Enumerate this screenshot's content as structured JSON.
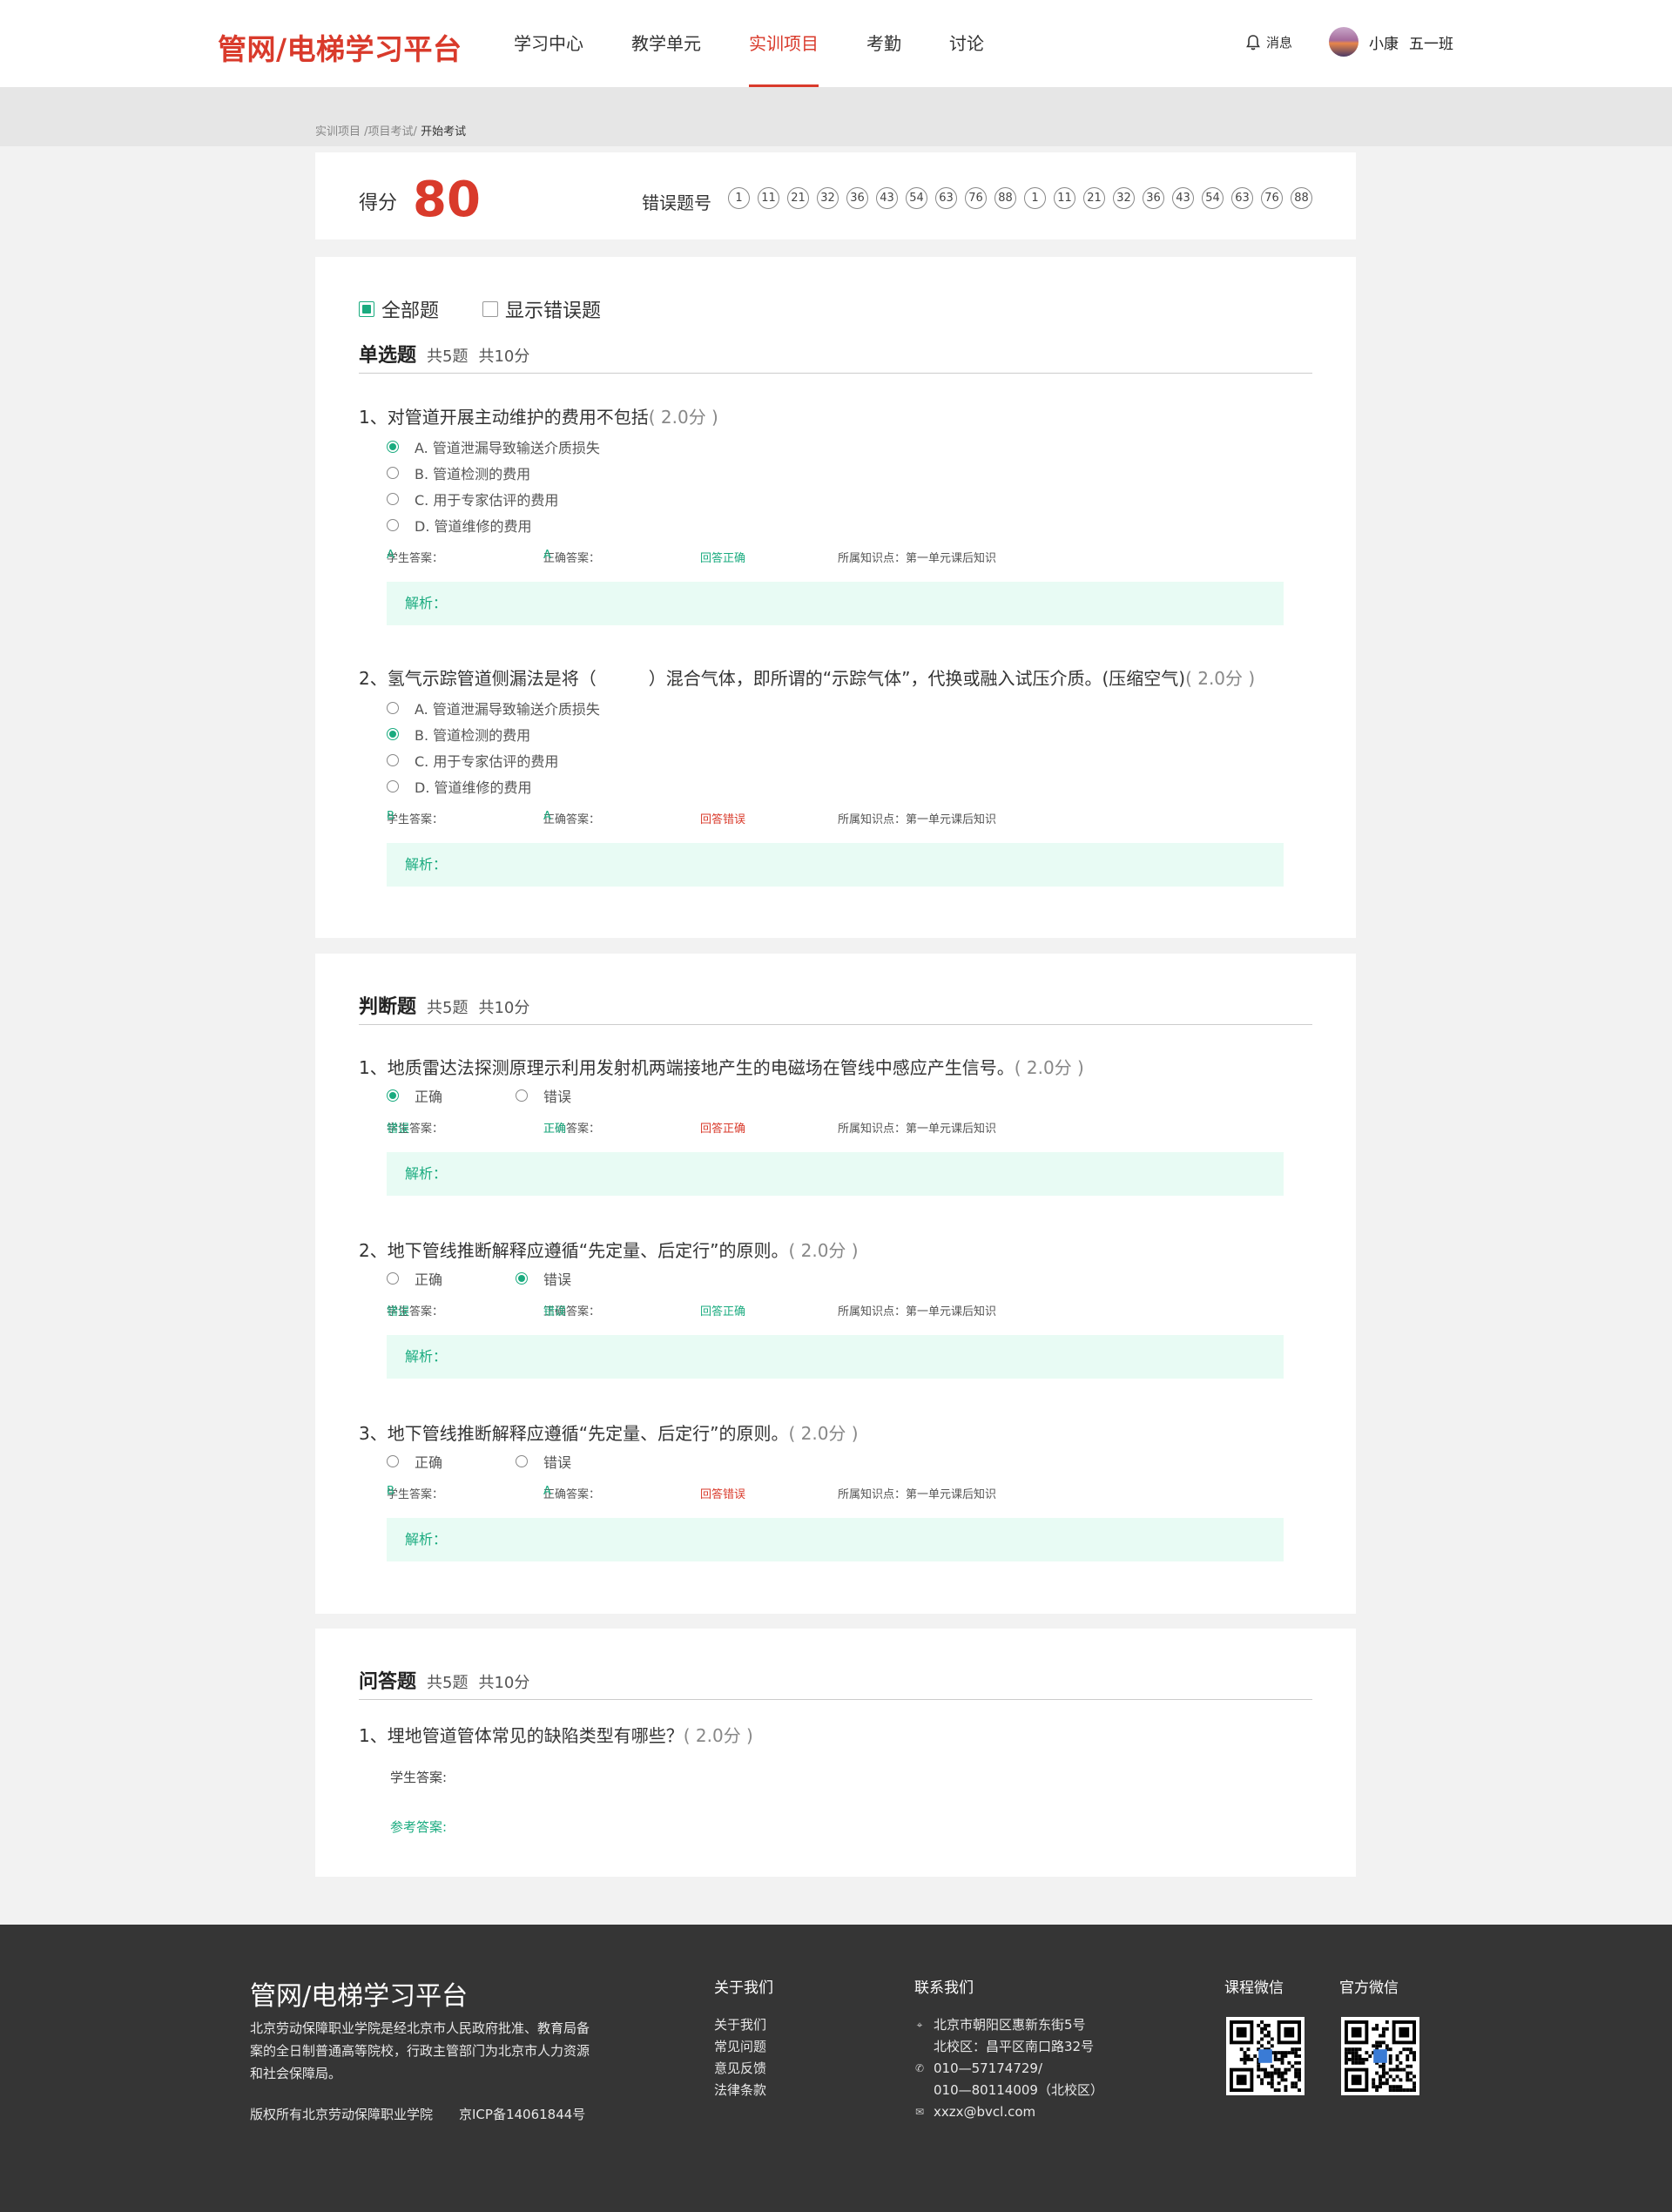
{
  "header": {
    "logo": "管网/电梯学习平台",
    "nav": [
      "学习中心",
      "教学单元",
      "实训项目",
      "考勤",
      "讨论"
    ],
    "active_nav": 2,
    "message_label": "消息",
    "user_name": "小康",
    "user_class": "五一班"
  },
  "breadcrumb": {
    "part1": "实训项目",
    "sep1": " /",
    "part2": "项目考试",
    "sep2": "/ ",
    "current": "开始考试"
  },
  "score": {
    "label": "得分",
    "value": "80",
    "wrong_label": "错误题号",
    "wrong_numbers": [
      "1",
      "11",
      "21",
      "32",
      "36",
      "43",
      "54",
      "63",
      "76",
      "88",
      "1",
      "11",
      "21",
      "32",
      "36",
      "43",
      "54",
      "63",
      "76",
      "88"
    ]
  },
  "filters": {
    "all_label": "全部题",
    "wrong_only_label": "显示错误题"
  },
  "single_choice": {
    "title": "单选题",
    "count": "共5题",
    "total": "共10分",
    "questions": [
      {
        "title": "1、对管道开展主动维护的费用不包括",
        "score": "( 2.0分 )",
        "options": [
          "A. 管道泄漏导致输送介质损失",
          "B. 管道检测的费用",
          "C. 用于专家估评的费用",
          "D. 管道维修的费用"
        ],
        "selected": 0,
        "student_label": "学生答案：",
        "student_answer": "A",
        "correct_label": "正确答案：",
        "correct_answer": "A",
        "result": "回答正确",
        "knowledge": "所属知识点：第一单元课后知识",
        "analysis": "解析："
      },
      {
        "title": "2、氢气示踪管道侧漏法是将（　　　）混合气体，即所谓的“示踪气体”，代换或融入试压介质。(压缩空气)",
        "score": "( 2.0分 )",
        "options": [
          "A. 管道泄漏导致输送介质损失",
          "B. 管道检测的费用",
          "C. 用于专家估评的费用",
          "D. 管道维修的费用"
        ],
        "selected": 1,
        "student_label": "学生答案：",
        "student_answer": "B",
        "correct_label": "正确答案：",
        "correct_answer": "A",
        "result": "回答错误",
        "knowledge": "所属知识点：第一单元课后知识",
        "analysis": "解析："
      }
    ]
  },
  "judgement": {
    "title": "判断题",
    "count": "共5题",
    "total": "共10分",
    "true_label": "正确",
    "false_label": "错误",
    "questions": [
      {
        "title": "1、地质雷达法探测原理示利用发射机两端接地产生的电磁场在管线中感应产生信号。",
        "score": "( 2.0分 )",
        "selected": 0,
        "student_label": "学生答案：",
        "student_answer": "错误",
        "correct_label": "正确答案：",
        "correct_answer": "正确",
        "result": "回答正确",
        "knowledge": "所属知识点：第一单元课后知识",
        "analysis": "解析："
      },
      {
        "title": "2、地下管线推断解释应遵循“先定量、后定行”的原则。",
        "score": "( 2.0分 )",
        "selected": 1,
        "student_label": "学生答案：",
        "student_answer": "错误",
        "correct_label": "正确答案：",
        "correct_answer": "错误",
        "result": "回答正确",
        "knowledge": "所属知识点：第一单元课后知识",
        "analysis": "解析："
      },
      {
        "title": "3、地下管线推断解释应遵循“先定量、后定行”的原则。",
        "score": "( 2.0分 )",
        "selected": -1,
        "student_label": "学生答案：",
        "student_answer": "B",
        "correct_label": "正确答案：",
        "correct_answer": "A",
        "result": "回答错误",
        "knowledge": "所属知识点：第一单元课后知识",
        "analysis": "解析："
      }
    ]
  },
  "qa": {
    "title": "问答题",
    "count": "共5题",
    "total": "共10分",
    "question": "1、埋地管道管体常见的缺陷类型有哪些？",
    "score": "( 2.0分 )",
    "student_label": "学生答案:",
    "reference_label": "参考答案:"
  },
  "footer": {
    "title": "管网/电梯学习平台",
    "desc": "北京劳动保障职业学院是经北京市人民政府批准、教育局备案的全日制普通高等院校，行政主管部门为北京市人力资源和社会保障局。",
    "copyright": "版权所有北京劳动保障职业学院　　京ICP备14061844号",
    "about_title": "关于我们",
    "about_links": [
      "关于我们",
      "常见问题",
      "意见反馈",
      "法律条款"
    ],
    "contact_title": "联系我们",
    "address1": "北京市朝阳区惠新东街5号",
    "address2": "北校区：昌平区南口路32号",
    "phone1": "010—57174729/",
    "phone2": "010—80114009（北校区）",
    "email": "xxzx@bvcl.com",
    "wechat_course": "课程微信",
    "wechat_official": "官方微信"
  },
  "colors": {
    "brand_red": "#d93a2b",
    "green": "#1aab7f",
    "analysis_bg": "#e8fbf4",
    "footer_bg": "#353535"
  }
}
